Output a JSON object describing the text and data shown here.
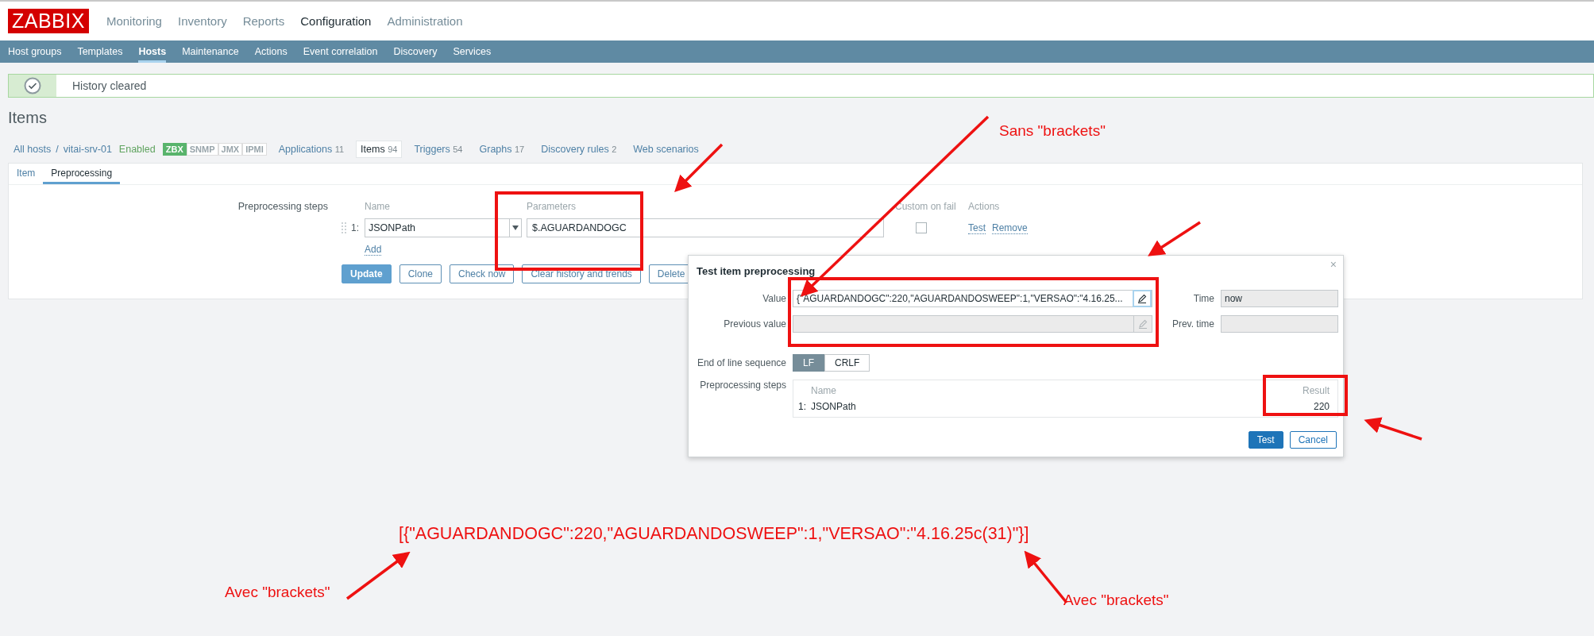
{
  "header": {
    "logo": "ZABBIX",
    "menu": [
      {
        "label": "Monitoring",
        "selected": false
      },
      {
        "label": "Inventory",
        "selected": false
      },
      {
        "label": "Reports",
        "selected": false
      },
      {
        "label": "Configuration",
        "selected": true
      },
      {
        "label": "Administration",
        "selected": false
      }
    ]
  },
  "subnav": [
    {
      "label": "Host groups",
      "selected": false
    },
    {
      "label": "Templates",
      "selected": false
    },
    {
      "label": "Hosts",
      "selected": true
    },
    {
      "label": "Maintenance",
      "selected": false
    },
    {
      "label": "Actions",
      "selected": false
    },
    {
      "label": "Event correlation",
      "selected": false
    },
    {
      "label": "Discovery",
      "selected": false
    },
    {
      "label": "Services",
      "selected": false
    }
  ],
  "message": {
    "text": "History cleared"
  },
  "page_title": "Items",
  "breadcrumb": {
    "all": "All hosts",
    "separator": "/",
    "host": "vitai-srv-01",
    "status": "Enabled"
  },
  "interfaces": [
    {
      "label": "ZBX",
      "on": true
    },
    {
      "label": "SNMP",
      "on": false
    },
    {
      "label": "JMX",
      "on": false
    },
    {
      "label": "IPMI",
      "on": false
    }
  ],
  "host_tabs": [
    {
      "label": "Applications",
      "count": "11",
      "selected": false
    },
    {
      "label": "Items",
      "count": "94",
      "selected": true
    },
    {
      "label": "Triggers",
      "count": "54",
      "selected": false
    },
    {
      "label": "Graphs",
      "count": "17",
      "selected": false
    },
    {
      "label": "Discovery rules",
      "count": "2",
      "selected": false
    },
    {
      "label": "Web scenarios",
      "selected": false
    }
  ],
  "form_tabs": [
    {
      "label": "Item",
      "selected": false
    },
    {
      "label": "Preprocessing",
      "selected": true
    }
  ],
  "preprocessing": {
    "label": "Preprocessing steps",
    "columns": [
      "Name",
      "Parameters",
      "Custom on fail",
      "Actions"
    ],
    "steps": [
      {
        "number": "1:",
        "name": "JSONPath",
        "parameter": "$.AGUARDANDOGC",
        "custom_on_fail": false,
        "actions": [
          "Test",
          "Remove"
        ]
      }
    ],
    "add": "Add"
  },
  "buttons": [
    {
      "label": "Update",
      "kind": "primary"
    },
    {
      "label": "Clone",
      "kind": "secondary"
    },
    {
      "label": "Check now",
      "kind": "secondary"
    },
    {
      "label": "Clear history and trends",
      "kind": "secondary"
    },
    {
      "label": "Delete",
      "kind": "secondary"
    }
  ],
  "dialog": {
    "title": "Test item preprocessing",
    "close": "×",
    "value_label": "Value",
    "value": "{\"AGUARDANDOGC\":220,\"AGUARDANDOSWEEP\":1,\"VERSAO\":\"4.16.25...",
    "time_label": "Time",
    "time": "now",
    "previous_value_label": "Previous value",
    "prev_time_label": "Prev. time",
    "eol_label": "End of line sequence",
    "eol_options": [
      {
        "label": "LF",
        "selected": true
      },
      {
        "label": "CRLF",
        "selected": false
      }
    ],
    "steps_label": "Preprocessing steps",
    "steps_columns": [
      "Name",
      "Result"
    ],
    "steps": [
      {
        "number": "1:",
        "name": "JSONPath",
        "result": "220"
      }
    ],
    "buttons": [
      {
        "label": "Test",
        "kind": "primary"
      },
      {
        "label": "Cancel",
        "kind": "secondary"
      }
    ]
  },
  "annotations": [
    {
      "kind": "note",
      "text": "Sans \"brackets\""
    },
    {
      "kind": "code",
      "text": "[{\"AGUARDANDOGC\":220,\"AGUARDANDOSWEEP\":1,\"VERSAO\":\"4.16.25c(31)\"}]"
    },
    {
      "kind": "note",
      "text": "Avec \"brackets\""
    },
    {
      "kind": "note",
      "text": "Avec \"brackets\""
    }
  ]
}
